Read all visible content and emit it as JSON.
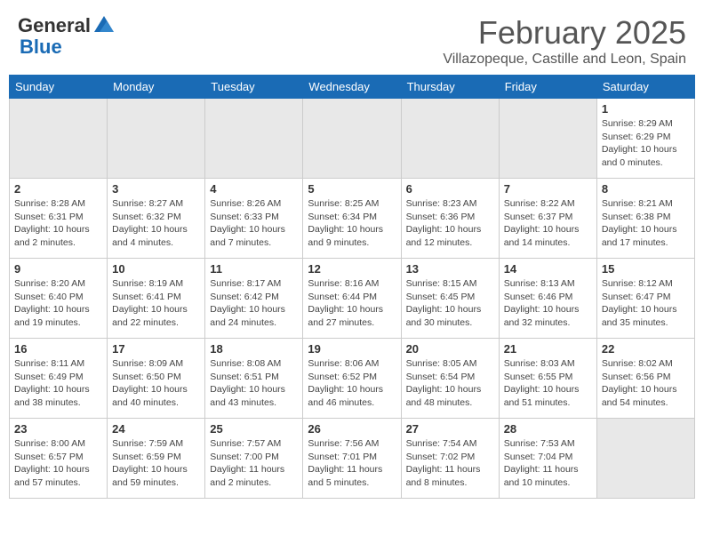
{
  "header": {
    "logo_general": "General",
    "logo_blue": "Blue",
    "month_title": "February 2025",
    "location": "Villazopeque, Castille and Leon, Spain"
  },
  "weekdays": [
    "Sunday",
    "Monday",
    "Tuesday",
    "Wednesday",
    "Thursday",
    "Friday",
    "Saturday"
  ],
  "weeks": [
    [
      {
        "day": "",
        "info": "",
        "empty": true
      },
      {
        "day": "",
        "info": "",
        "empty": true
      },
      {
        "day": "",
        "info": "",
        "empty": true
      },
      {
        "day": "",
        "info": "",
        "empty": true
      },
      {
        "day": "",
        "info": "",
        "empty": true
      },
      {
        "day": "",
        "info": "",
        "empty": true
      },
      {
        "day": "1",
        "info": "Sunrise: 8:29 AM\nSunset: 6:29 PM\nDaylight: 10 hours\nand 0 minutes."
      }
    ],
    [
      {
        "day": "2",
        "info": "Sunrise: 8:28 AM\nSunset: 6:31 PM\nDaylight: 10 hours\nand 2 minutes."
      },
      {
        "day": "3",
        "info": "Sunrise: 8:27 AM\nSunset: 6:32 PM\nDaylight: 10 hours\nand 4 minutes."
      },
      {
        "day": "4",
        "info": "Sunrise: 8:26 AM\nSunset: 6:33 PM\nDaylight: 10 hours\nand 7 minutes."
      },
      {
        "day": "5",
        "info": "Sunrise: 8:25 AM\nSunset: 6:34 PM\nDaylight: 10 hours\nand 9 minutes."
      },
      {
        "day": "6",
        "info": "Sunrise: 8:23 AM\nSunset: 6:36 PM\nDaylight: 10 hours\nand 12 minutes."
      },
      {
        "day": "7",
        "info": "Sunrise: 8:22 AM\nSunset: 6:37 PM\nDaylight: 10 hours\nand 14 minutes."
      },
      {
        "day": "8",
        "info": "Sunrise: 8:21 AM\nSunset: 6:38 PM\nDaylight: 10 hours\nand 17 minutes."
      }
    ],
    [
      {
        "day": "9",
        "info": "Sunrise: 8:20 AM\nSunset: 6:40 PM\nDaylight: 10 hours\nand 19 minutes."
      },
      {
        "day": "10",
        "info": "Sunrise: 8:19 AM\nSunset: 6:41 PM\nDaylight: 10 hours\nand 22 minutes."
      },
      {
        "day": "11",
        "info": "Sunrise: 8:17 AM\nSunset: 6:42 PM\nDaylight: 10 hours\nand 24 minutes."
      },
      {
        "day": "12",
        "info": "Sunrise: 8:16 AM\nSunset: 6:44 PM\nDaylight: 10 hours\nand 27 minutes."
      },
      {
        "day": "13",
        "info": "Sunrise: 8:15 AM\nSunset: 6:45 PM\nDaylight: 10 hours\nand 30 minutes."
      },
      {
        "day": "14",
        "info": "Sunrise: 8:13 AM\nSunset: 6:46 PM\nDaylight: 10 hours\nand 32 minutes."
      },
      {
        "day": "15",
        "info": "Sunrise: 8:12 AM\nSunset: 6:47 PM\nDaylight: 10 hours\nand 35 minutes."
      }
    ],
    [
      {
        "day": "16",
        "info": "Sunrise: 8:11 AM\nSunset: 6:49 PM\nDaylight: 10 hours\nand 38 minutes."
      },
      {
        "day": "17",
        "info": "Sunrise: 8:09 AM\nSunset: 6:50 PM\nDaylight: 10 hours\nand 40 minutes."
      },
      {
        "day": "18",
        "info": "Sunrise: 8:08 AM\nSunset: 6:51 PM\nDaylight: 10 hours\nand 43 minutes."
      },
      {
        "day": "19",
        "info": "Sunrise: 8:06 AM\nSunset: 6:52 PM\nDaylight: 10 hours\nand 46 minutes."
      },
      {
        "day": "20",
        "info": "Sunrise: 8:05 AM\nSunset: 6:54 PM\nDaylight: 10 hours\nand 48 minutes."
      },
      {
        "day": "21",
        "info": "Sunrise: 8:03 AM\nSunset: 6:55 PM\nDaylight: 10 hours\nand 51 minutes."
      },
      {
        "day": "22",
        "info": "Sunrise: 8:02 AM\nSunset: 6:56 PM\nDaylight: 10 hours\nand 54 minutes."
      }
    ],
    [
      {
        "day": "23",
        "info": "Sunrise: 8:00 AM\nSunset: 6:57 PM\nDaylight: 10 hours\nand 57 minutes."
      },
      {
        "day": "24",
        "info": "Sunrise: 7:59 AM\nSunset: 6:59 PM\nDaylight: 10 hours\nand 59 minutes."
      },
      {
        "day": "25",
        "info": "Sunrise: 7:57 AM\nSunset: 7:00 PM\nDaylight: 11 hours\nand 2 minutes."
      },
      {
        "day": "26",
        "info": "Sunrise: 7:56 AM\nSunset: 7:01 PM\nDaylight: 11 hours\nand 5 minutes."
      },
      {
        "day": "27",
        "info": "Sunrise: 7:54 AM\nSunset: 7:02 PM\nDaylight: 11 hours\nand 8 minutes."
      },
      {
        "day": "28",
        "info": "Sunrise: 7:53 AM\nSunset: 7:04 PM\nDaylight: 11 hours\nand 10 minutes."
      },
      {
        "day": "",
        "info": "",
        "empty": true
      }
    ]
  ]
}
